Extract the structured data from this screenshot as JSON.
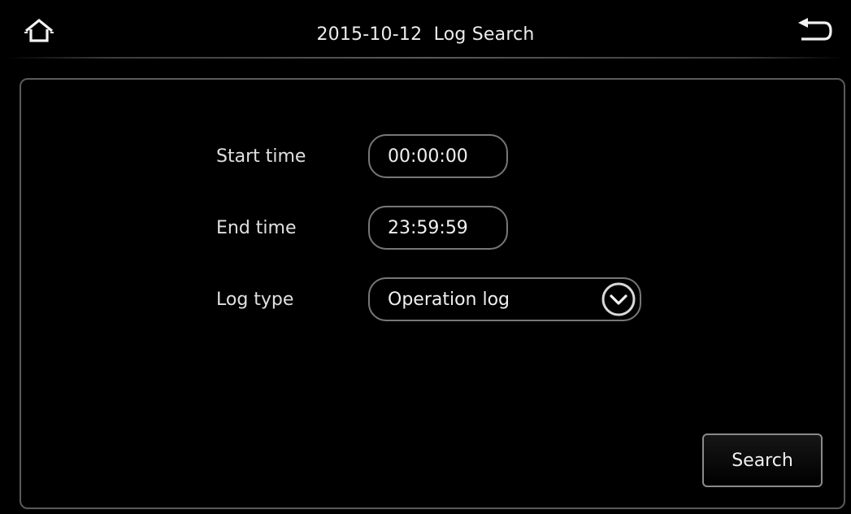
{
  "header": {
    "title": "2015-10-12  Log Search"
  },
  "form": {
    "start_time": {
      "label": "Start time",
      "value": "00:00:00"
    },
    "end_time": {
      "label": "End time",
      "value": "23:59:59"
    },
    "log_type": {
      "label": "Log type",
      "selected": "Operation log"
    }
  },
  "actions": {
    "search_label": "Search"
  },
  "icons": {
    "home": "home-icon",
    "back": "back-arrow-icon",
    "dropdown": "chevron-down-icon"
  },
  "colors": {
    "background": "#000000",
    "text": "#e6e6e6",
    "border": "#777777"
  }
}
